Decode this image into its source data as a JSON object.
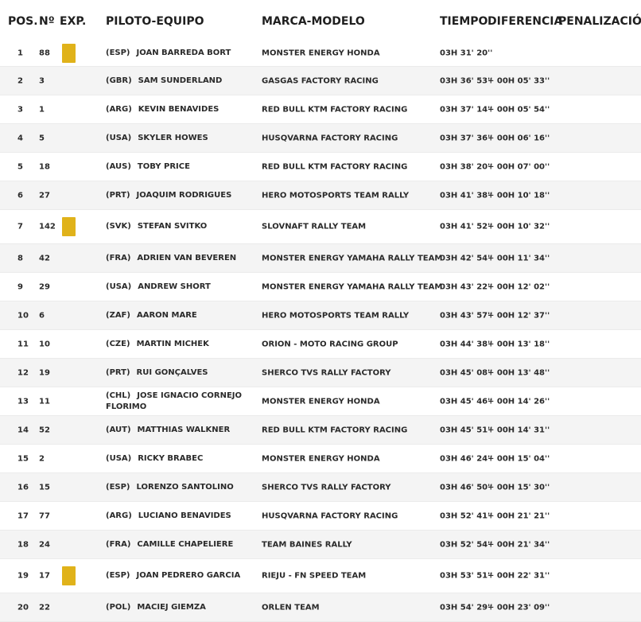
{
  "header": {
    "pos": "POS.",
    "num": "Nº",
    "exp": "EXP.",
    "rider": "PILOTO-EQUIPO",
    "team": "MARCA-MODELO",
    "time": "TIEMPO",
    "diff": "DIFERENCIA",
    "penalty": "PENALIZACIÓN"
  },
  "colors": {
    "expert_badge": "#e0b21a",
    "alt_row": "#f4f4f4"
  },
  "rows": [
    {
      "pos": "1",
      "num": "88",
      "exp": true,
      "nat": "(ESP)",
      "rider": "JOAN BARREDA BORT",
      "team": "MONSTER ENERGY HONDA",
      "time": "03H 31' 20''",
      "diff": "",
      "penalty": ""
    },
    {
      "pos": "2",
      "num": "3",
      "exp": false,
      "nat": "(GBR)",
      "rider": "SAM SUNDERLAND",
      "team": "GASGAS FACTORY RACING",
      "time": "03H 36' 53''",
      "diff": "+ 00H 05' 33''",
      "penalty": ""
    },
    {
      "pos": "3",
      "num": "1",
      "exp": false,
      "nat": "(ARG)",
      "rider": "KEVIN BENAVIDES",
      "team": "RED BULL KTM FACTORY RACING",
      "time": "03H 37' 14''",
      "diff": "+ 00H 05' 54''",
      "penalty": ""
    },
    {
      "pos": "4",
      "num": "5",
      "exp": false,
      "nat": "(USA)",
      "rider": "SKYLER HOWES",
      "team": "HUSQVARNA FACTORY RACING",
      "time": "03H 37' 36''",
      "diff": "+ 00H 06' 16''",
      "penalty": ""
    },
    {
      "pos": "5",
      "num": "18",
      "exp": false,
      "nat": "(AUS)",
      "rider": "TOBY PRICE",
      "team": "RED BULL KTM FACTORY RACING",
      "time": "03H 38' 20''",
      "diff": "+ 00H 07' 00''",
      "penalty": ""
    },
    {
      "pos": "6",
      "num": "27",
      "exp": false,
      "nat": "(PRT)",
      "rider": "JOAQUIM RODRIGUES",
      "team": "HERO MOTOSPORTS TEAM RALLY",
      "time": "03H 41' 38''",
      "diff": "+ 00H 10' 18''",
      "penalty": ""
    },
    {
      "pos": "7",
      "num": "142",
      "exp": true,
      "nat": "(SVK)",
      "rider": "STEFAN SVITKO",
      "team": "SLOVNAFT RALLY TEAM",
      "time": "03H 41' 52''",
      "diff": "+ 00H 10' 32''",
      "penalty": ""
    },
    {
      "pos": "8",
      "num": "42",
      "exp": false,
      "nat": "(FRA)",
      "rider": "ADRIEN VAN BEVEREN",
      "team": "MONSTER ENERGY YAMAHA RALLY TEAM",
      "time": "03H 42' 54''",
      "diff": "+ 00H 11' 34''",
      "penalty": ""
    },
    {
      "pos": "9",
      "num": "29",
      "exp": false,
      "nat": "(USA)",
      "rider": "ANDREW SHORT",
      "team": "MONSTER ENERGY YAMAHA RALLY TEAM",
      "time": "03H 43' 22''",
      "diff": "+ 00H 12' 02''",
      "penalty": ""
    },
    {
      "pos": "10",
      "num": "6",
      "exp": false,
      "nat": "(ZAF)",
      "rider": "AARON MARE",
      "team": "HERO MOTOSPORTS TEAM RALLY",
      "time": "03H 43' 57''",
      "diff": "+ 00H 12' 37''",
      "penalty": ""
    },
    {
      "pos": "11",
      "num": "10",
      "exp": false,
      "nat": "(CZE)",
      "rider": "MARTIN MICHEK",
      "team": "ORION - MOTO RACING GROUP",
      "time": "03H 44' 38''",
      "diff": "+ 00H 13' 18''",
      "penalty": ""
    },
    {
      "pos": "12",
      "num": "19",
      "exp": false,
      "nat": "(PRT)",
      "rider": "RUI GONÇALVES",
      "team": "SHERCO TVS RALLY FACTORY",
      "time": "03H 45' 08''",
      "diff": "+ 00H 13' 48''",
      "penalty": ""
    },
    {
      "pos": "13",
      "num": "11",
      "exp": false,
      "nat": "(CHL)",
      "rider": "JOSE IGNACIO CORNEJO FLORIMO",
      "team": "MONSTER ENERGY HONDA",
      "time": "03H 45' 46''",
      "diff": "+ 00H 14' 26''",
      "penalty": ""
    },
    {
      "pos": "14",
      "num": "52",
      "exp": false,
      "nat": "(AUT)",
      "rider": "MATTHIAS WALKNER",
      "team": "RED BULL KTM FACTORY RACING",
      "time": "03H 45' 51''",
      "diff": "+ 00H 14' 31''",
      "penalty": ""
    },
    {
      "pos": "15",
      "num": "2",
      "exp": false,
      "nat": "(USA)",
      "rider": "RICKY BRABEC",
      "team": "MONSTER ENERGY HONDA",
      "time": "03H 46' 24''",
      "diff": "+ 00H 15' 04''",
      "penalty": ""
    },
    {
      "pos": "16",
      "num": "15",
      "exp": false,
      "nat": "(ESP)",
      "rider": "LORENZO SANTOLINO",
      "team": "SHERCO TVS RALLY FACTORY",
      "time": "03H 46' 50''",
      "diff": "+ 00H 15' 30''",
      "penalty": ""
    },
    {
      "pos": "17",
      "num": "77",
      "exp": false,
      "nat": "(ARG)",
      "rider": "LUCIANO BENAVIDES",
      "team": "HUSQVARNA FACTORY RACING",
      "time": "03H 52' 41''",
      "diff": "+ 00H 21' 21''",
      "penalty": ""
    },
    {
      "pos": "18",
      "num": "24",
      "exp": false,
      "nat": "(FRA)",
      "rider": "CAMILLE CHAPELIERE",
      "team": "TEAM BAINES RALLY",
      "time": "03H 52' 54''",
      "diff": "+ 00H 21' 34''",
      "penalty": ""
    },
    {
      "pos": "19",
      "num": "17",
      "exp": true,
      "nat": "(ESP)",
      "rider": "JOAN PEDRERO GARCIA",
      "team": "RIEJU - FN SPEED TEAM",
      "time": "03H 53' 51''",
      "diff": "+ 00H 22' 31''",
      "penalty": ""
    },
    {
      "pos": "20",
      "num": "22",
      "exp": false,
      "nat": "(POL)",
      "rider": "MACIEJ GIEMZA",
      "team": "ORLEN TEAM",
      "time": "03H 54' 29''",
      "diff": "+ 00H 23' 09''",
      "penalty": ""
    }
  ]
}
